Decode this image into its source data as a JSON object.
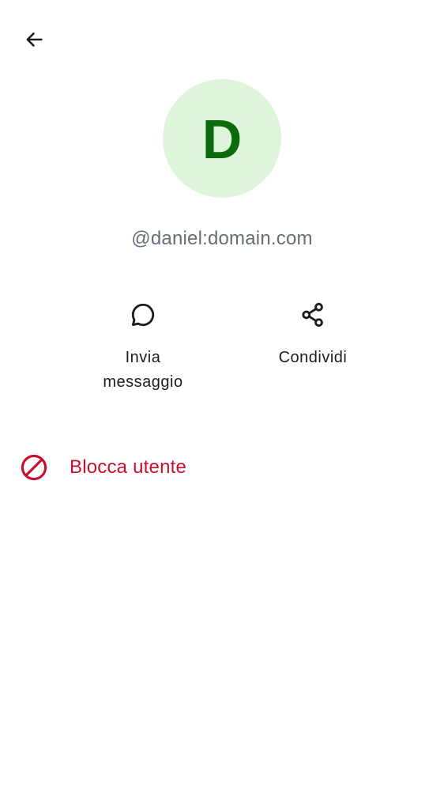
{
  "header": {
    "back_icon": "arrow-left-icon"
  },
  "profile": {
    "avatar_letter": "D",
    "avatar_bg_color": "#dff5db",
    "avatar_letter_color": "#0b6b0b",
    "user_id": "@daniel:domain.com"
  },
  "actions": [
    {
      "icon": "chat-bubble-icon",
      "label": "Invia\nmessaggio"
    },
    {
      "icon": "share-icon",
      "label": "Condividi"
    }
  ],
  "block": {
    "icon": "block-icon",
    "label": "Blocca utente",
    "color": "#c8102e"
  }
}
